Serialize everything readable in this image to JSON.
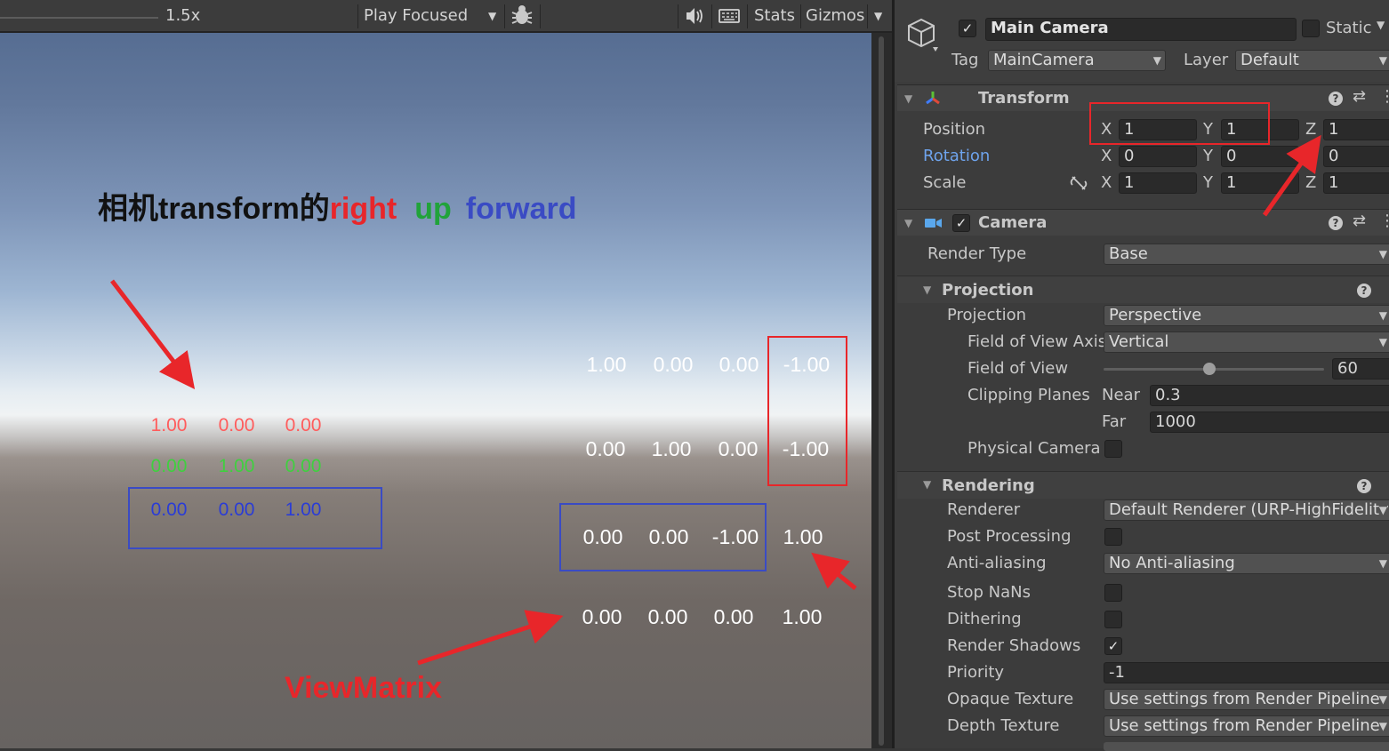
{
  "game_view": {
    "toolbar": {
      "scale_value": "1.5x",
      "play_mode": "Play Focused",
      "stats_label": "Stats",
      "gizmos_label": "Gizmos"
    }
  },
  "annotations": {
    "heading_prefix": "相机transform的",
    "heading_right": "right",
    "heading_up": "up",
    "heading_forward": "forward",
    "viewmatrix_label": "ViewMatrix",
    "transform_axes": [
      {
        "name": "right",
        "color": "#ff5555",
        "values": [
          "1.00",
          "0.00",
          "0.00"
        ]
      },
      {
        "name": "up",
        "color": "#3fd03f",
        "values": [
          "0.00",
          "1.00",
          "0.00"
        ]
      },
      {
        "name": "forward",
        "color": "#2a3cd6",
        "values": [
          "0.00",
          "0.00",
          "1.00"
        ]
      }
    ],
    "view_matrix": [
      [
        "1.00",
        "0.00",
        "0.00",
        "-1.00"
      ],
      [
        "0.00",
        "1.00",
        "0.00",
        "-1.00"
      ],
      [
        "0.00",
        "0.00",
        "-1.00",
        "1.00"
      ],
      [
        "0.00",
        "0.00",
        "0.00",
        "1.00"
      ]
    ],
    "colors": {
      "red": "#e8262a",
      "green": "#21a33a",
      "blue": "#3a4bc4"
    }
  },
  "inspector": {
    "object_name": "Main Camera",
    "static_label": "Static",
    "tag_label": "Tag",
    "tag_value": "MainCamera",
    "layer_label": "Layer",
    "layer_value": "Default",
    "transform": {
      "title": "Transform",
      "position_label": "Position",
      "rotation_label": "Rotation",
      "scale_label": "Scale",
      "axis_x": "X",
      "axis_y": "Y",
      "axis_z": "Z",
      "position": [
        "1",
        "1",
        "1"
      ],
      "rotation": [
        "0",
        "0",
        "0"
      ],
      "scale": [
        "1",
        "1",
        "1"
      ]
    },
    "camera": {
      "title": "Camera",
      "render_type_label": "Render Type",
      "render_type": "Base",
      "projection_section": "Projection",
      "projection_label": "Projection",
      "projection_value": "Perspective",
      "fov_axis_label": "Field of View Axis",
      "fov_axis_value": "Vertical",
      "fov_label": "Field of View",
      "fov_value": "60",
      "fov_fraction": 0.48,
      "clipping_label": "Clipping Planes",
      "near_label": "Near",
      "near_value": "0.3",
      "far_label": "Far",
      "far_value": "1000",
      "physical_camera_label": "Physical Camera",
      "rendering_section": "Rendering",
      "renderer_label": "Renderer",
      "renderer_value": "Default Renderer (URP-HighFidelity)",
      "post_processing_label": "Post Processing",
      "anti_aliasing_label": "Anti-aliasing",
      "anti_aliasing_value": "No Anti-aliasing",
      "stop_nans_label": "Stop NaNs",
      "dithering_label": "Dithering",
      "render_shadows_label": "Render Shadows",
      "priority_label": "Priority",
      "priority_value": "-1",
      "opaque_texture_label": "Opaque Texture",
      "opaque_texture_value": "Use settings from Render Pipeline",
      "depth_texture_label": "Depth Texture",
      "depth_texture_value": "Use settings from Render Pipeline"
    }
  }
}
